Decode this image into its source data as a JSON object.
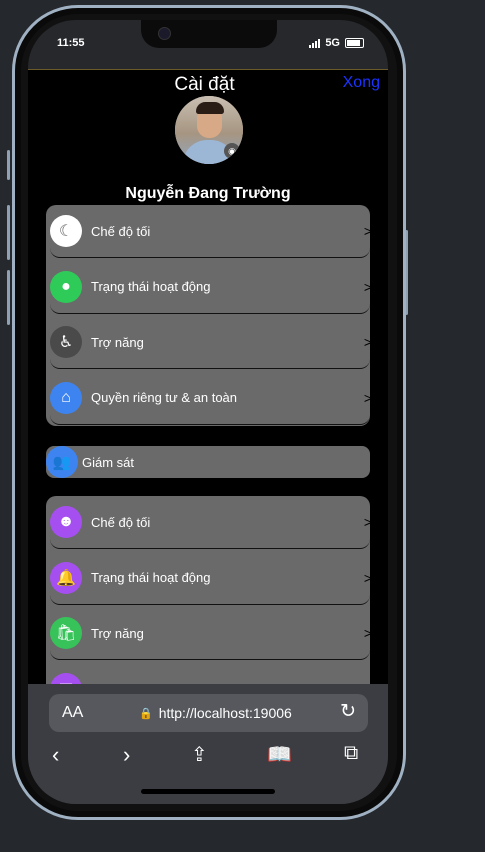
{
  "status": {
    "time": "11:55",
    "network": "5G"
  },
  "header": {
    "title": "Cài đặt",
    "done_label": "Xong"
  },
  "profile": {
    "name": "Nguyễn Đang Trường"
  },
  "groups": [
    [
      {
        "label": "Chế độ tối",
        "icon": "moon-icon",
        "color": "#ffffff",
        "glyph": "☾"
      },
      {
        "label": "Trạng thái hoạt động",
        "icon": "active-status-icon",
        "color": "#2fcb59",
        "glyph": "●"
      },
      {
        "label": "Trợ năng",
        "icon": "accessibility-icon",
        "color": "#4a4a4a",
        "glyph": "♿"
      },
      {
        "label": "Quyền riêng tư & an toàn",
        "icon": "privacy-home-icon",
        "color": "#3e84f0",
        "glyph": "⌂"
      }
    ],
    [
      {
        "label": "Chế độ tối",
        "icon": "smile-icon",
        "color": "#a64ff0",
        "glyph": "☻"
      },
      {
        "label": "Trạng thái hoạt động",
        "icon": "bell-icon",
        "color": "#a64ff0",
        "glyph": "🔔"
      },
      {
        "label": "Trợ năng",
        "icon": "shopping-bag-icon",
        "color": "#37c25a",
        "glyph": "🛍"
      },
      {
        "label": "",
        "icon": "purple-square-icon",
        "color": "#a64ff0",
        "glyph": "▣"
      }
    ]
  ],
  "supervision": {
    "label": "Giám sát",
    "icon": "people-icon",
    "color": "#3e84f0"
  },
  "browser": {
    "aa_label": "AA",
    "url": "http://localhost:19006"
  },
  "chevron": ">"
}
